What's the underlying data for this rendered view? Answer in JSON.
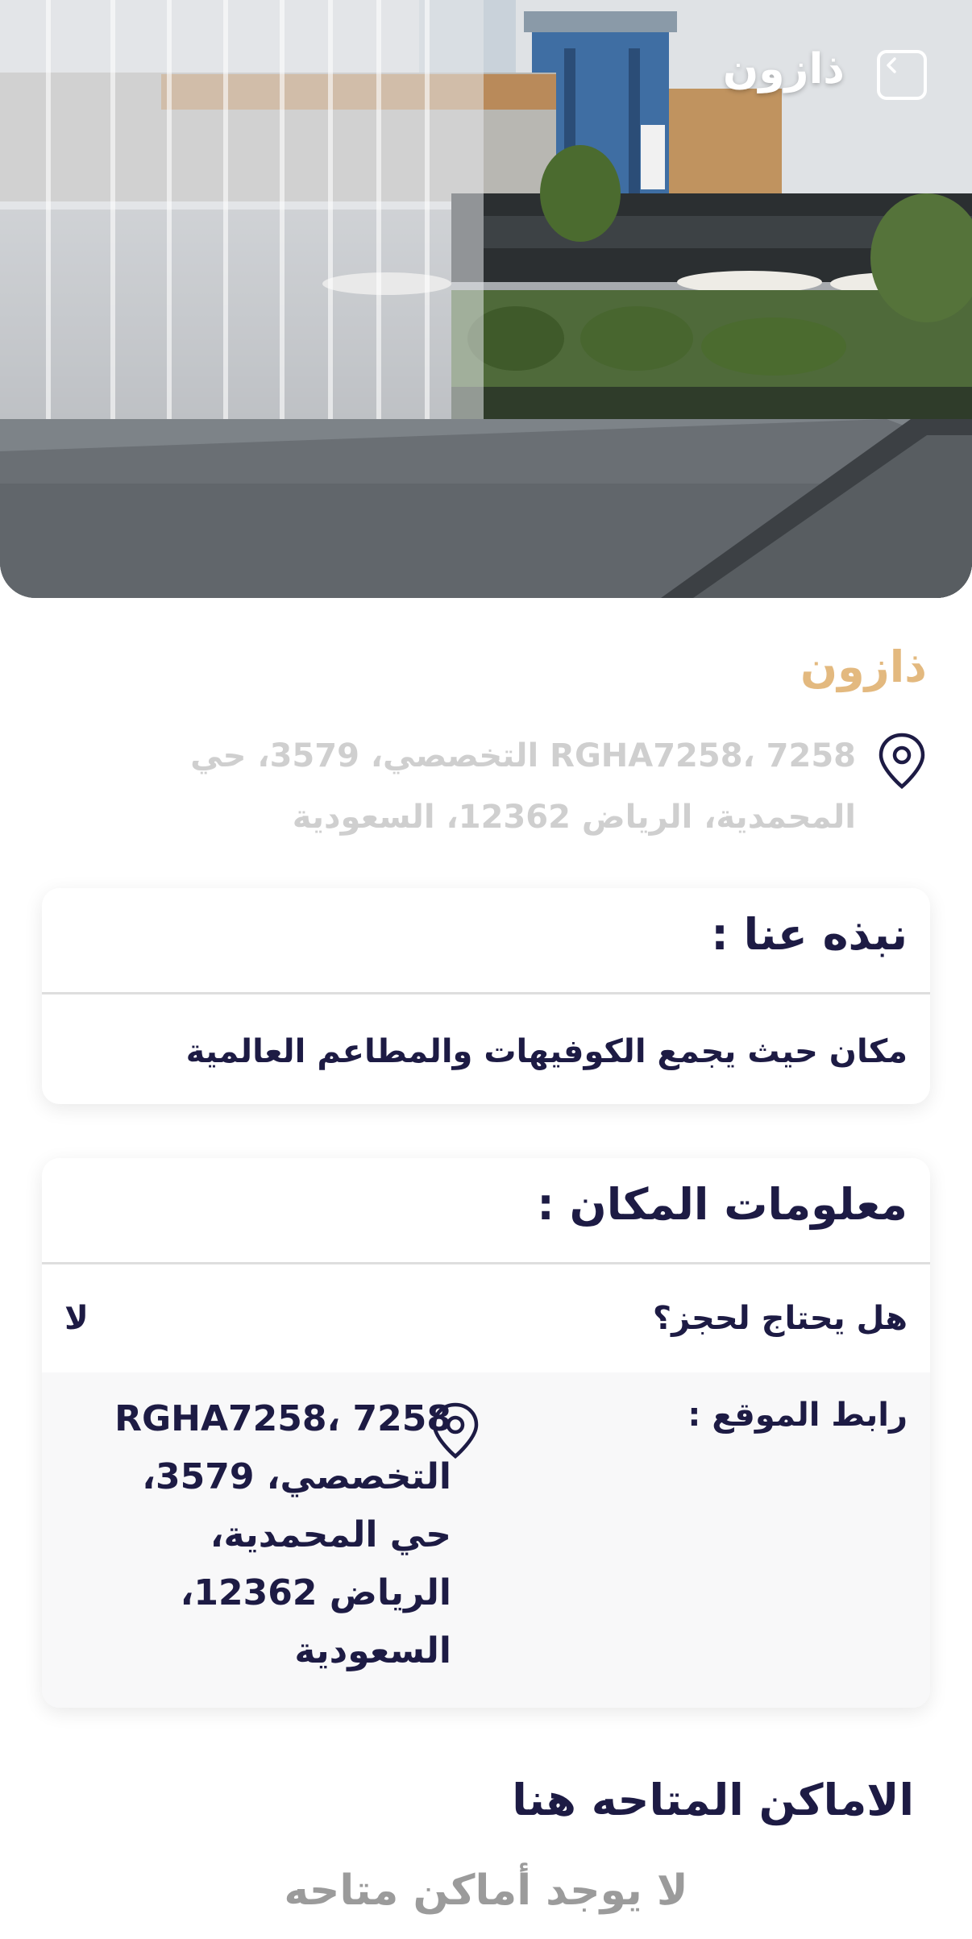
{
  "header": {
    "title": "ذازون",
    "back_icon": "chevron-left-icon"
  },
  "place": {
    "name": "ذازون",
    "address_line1": "7258 ،RGHA7258 التخصصي، 3579، حي",
    "address_line2": "المحمدية، الرياض 12362، السعودية",
    "address_icon": "map-pin-icon"
  },
  "about": {
    "title": "نبذه عنا :",
    "text": "مكان حيث يجمع الكوفيهات والمطاعم العالمية"
  },
  "info": {
    "title": "معلومات المكان :",
    "booking_label": "هل يحتاج لحجز؟",
    "booking_value": "لا",
    "link_label": "رابط الموقع :",
    "link_address_lines": [
      "7258 ،RGHA7258",
      "التخصصي، 3579،",
      "حي المحمدية،",
      "الرياض 12362،",
      "السعودية"
    ]
  },
  "available": {
    "title": "الاماكن المتاحه هنا",
    "empty_text": "لا يوجد أماكن متاحه"
  },
  "colors": {
    "accent": "#e3b97f",
    "primary_text": "#1d1b44",
    "muted_text": "#cfcfcf",
    "empty_text": "#9b9b9b",
    "card_alt_bg": "#f8f8f9"
  }
}
